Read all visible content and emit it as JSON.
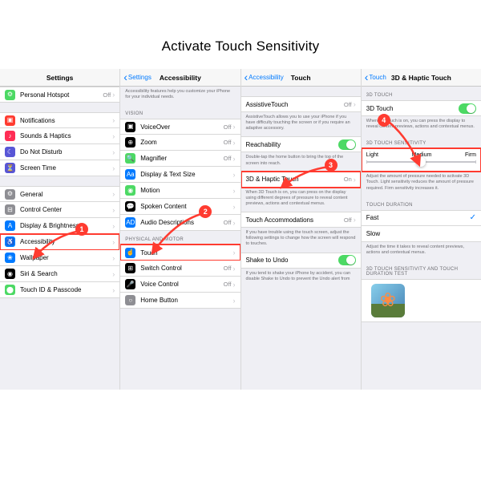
{
  "title": "Activate Touch Sensitivity",
  "panel1": {
    "nav_title": "Settings",
    "rows": [
      {
        "icon": "ic-green",
        "label": "Personal Hotspot",
        "value": "Off",
        "glyph": "⚙"
      },
      {
        "gap": true
      },
      {
        "icon": "ic-red",
        "label": "Notifications",
        "glyph": "▣"
      },
      {
        "icon": "ic-pink",
        "label": "Sounds & Haptics",
        "glyph": "♪"
      },
      {
        "icon": "ic-purple",
        "label": "Do Not Disturb",
        "glyph": "☾"
      },
      {
        "icon": "ic-purple",
        "label": "Screen Time",
        "glyph": "⏳"
      },
      {
        "gap": true
      },
      {
        "icon": "ic-gray",
        "label": "General",
        "glyph": "⚙"
      },
      {
        "icon": "ic-gray",
        "label": "Control Center",
        "glyph": "⊟"
      },
      {
        "icon": "ic-blue",
        "label": "Display & Brightness",
        "glyph": "A"
      },
      {
        "icon": "ic-blue",
        "label": "Accessibility",
        "glyph": "♿",
        "highlight": true
      },
      {
        "icon": "ic-blue",
        "label": "Wallpaper",
        "glyph": "❀"
      },
      {
        "icon": "ic-black",
        "label": "Siri & Search",
        "glyph": "◉"
      },
      {
        "icon": "ic-green",
        "label": "Touch ID & Passcode",
        "glyph": "⬤"
      }
    ]
  },
  "panel2": {
    "back": "Settings",
    "nav_title": "Accessibility",
    "desc_top": "Accessibility features help you customize your iPhone for your individual needs.",
    "section1": "VISION",
    "rows1": [
      {
        "icon": "ic-black",
        "label": "VoiceOver",
        "value": "Off",
        "glyph": "▣"
      },
      {
        "icon": "ic-black",
        "label": "Zoom",
        "value": "Off",
        "glyph": "⊕"
      },
      {
        "icon": "ic-green",
        "label": "Magnifier",
        "value": "Off",
        "glyph": "🔍"
      },
      {
        "icon": "ic-blue",
        "label": "Display & Text Size",
        "glyph": "Aa"
      },
      {
        "icon": "ic-green",
        "label": "Motion",
        "glyph": "◉"
      },
      {
        "icon": "ic-black",
        "label": "Spoken Content",
        "glyph": "💬"
      },
      {
        "icon": "ic-blue",
        "label": "Audio Descriptions",
        "value": "Off",
        "glyph": "AD"
      }
    ],
    "section2": "PHYSICAL AND MOTOR",
    "rows2": [
      {
        "icon": "ic-blue",
        "label": "Touch",
        "glyph": "☝",
        "highlight": true
      },
      {
        "icon": "ic-black",
        "label": "Switch Control",
        "value": "Off",
        "glyph": "⊞"
      },
      {
        "icon": "ic-black",
        "label": "Voice Control",
        "value": "Off",
        "glyph": "🎤"
      },
      {
        "icon": "ic-gray",
        "label": "Home Button",
        "glyph": "○"
      }
    ]
  },
  "panel3": {
    "back": "Accessibility",
    "nav_title": "Touch",
    "row_at": {
      "label": "AssistiveTouch",
      "value": "Off"
    },
    "desc_at": "AssistiveTouch allows you to use your iPhone if you have difficulty touching the screen or if you require an adaptive accessory.",
    "row_reach": {
      "label": "Reachability"
    },
    "desc_reach": "Double-tap the home button to bring the top of the screen into reach.",
    "row_3d": {
      "label": "3D & Haptic Touch",
      "value": "On"
    },
    "desc_3d": "When 3D Touch is on, you can press on the display using different degrees of pressure to reveal content previews, actions and contextual menus.",
    "row_ta": {
      "label": "Touch Accommodations",
      "value": "Off"
    },
    "desc_ta": "If you have trouble using the touch screen, adjust the following settings to change how the screen will respond to touches.",
    "row_shake": {
      "label": "Shake to Undo"
    },
    "desc_shake": "If you tend to shake your iPhone by accident, you can disable Shake to Undo to prevent the Undo alert from"
  },
  "panel4": {
    "back": "Touch",
    "nav_title": "3D & Haptic Touch",
    "section1": "3D TOUCH",
    "row_3d": {
      "label": "3D Touch"
    },
    "desc_3d": "When 3D Touch is on, you can press the display to reveal content previews, actions and contextual menus.",
    "section2": "3D TOUCH SENSITIVITY",
    "slider": {
      "left": "Light",
      "mid": "Medium",
      "right": "Firm"
    },
    "desc_sens": "Adjust the amount of pressure needed to activate 3D Touch. Light sensitivity reduces the amount of pressure required. Firm sensitivity increases it.",
    "section3": "TOUCH DURATION",
    "row_fast": "Fast",
    "row_slow": "Slow",
    "desc_dur": "Adjust the time it takes to reveal content previews, actions and contextual menus.",
    "section4": "3D TOUCH SENSITIVITY AND TOUCH DURATION TEST"
  },
  "steps": {
    "s1": "1",
    "s2": "2",
    "s3": "3",
    "s4": "4"
  }
}
